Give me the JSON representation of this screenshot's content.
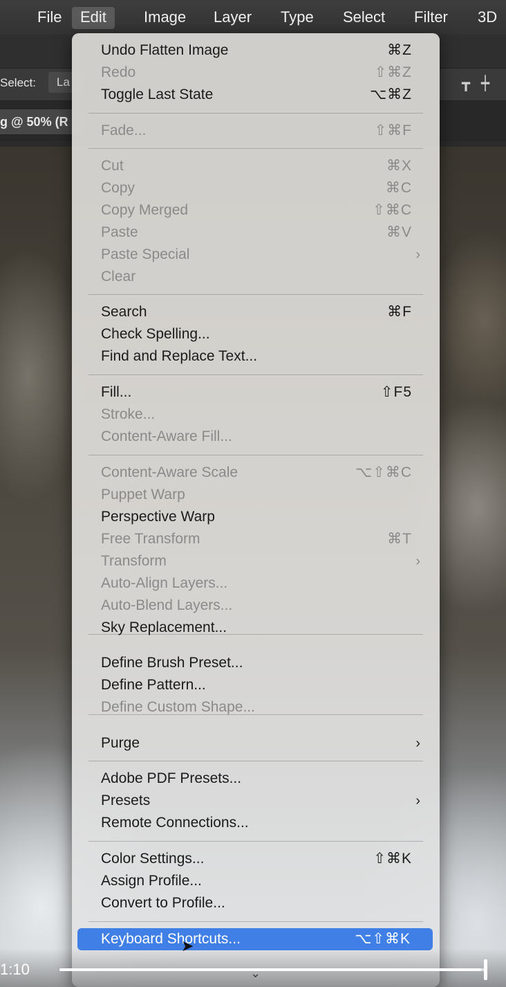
{
  "menubar": {
    "items": [
      {
        "label": "File"
      },
      {
        "label": "Edit"
      },
      {
        "label": "Image"
      },
      {
        "label": "Layer"
      },
      {
        "label": "Type"
      },
      {
        "label": "Select"
      },
      {
        "label": "Filter"
      },
      {
        "label": "3D"
      }
    ],
    "active": "Edit"
  },
  "options_bar": {
    "select_label": "Select:",
    "select_value": "La"
  },
  "document_tab": {
    "label": "g @ 50% (R"
  },
  "edit_menu": {
    "items": [
      {
        "label": "Undo Flatten Image",
        "shortcut": "⌘Z",
        "enabled": true
      },
      {
        "label": "Redo",
        "shortcut": "⇧⌘Z",
        "enabled": false
      },
      {
        "label": "Toggle Last State",
        "shortcut": "⌥⌘Z",
        "enabled": true
      },
      {
        "label": "Fade...",
        "shortcut": "⇧⌘F",
        "enabled": false
      },
      {
        "label": "Cut",
        "shortcut": "⌘X",
        "enabled": false
      },
      {
        "label": "Copy",
        "shortcut": "⌘C",
        "enabled": false
      },
      {
        "label": "Copy Merged",
        "shortcut": "⇧⌘C",
        "enabled": false
      },
      {
        "label": "Paste",
        "shortcut": "⌘V",
        "enabled": false
      },
      {
        "label": "Paste Special",
        "shortcut": "",
        "enabled": false,
        "submenu": true
      },
      {
        "label": "Clear",
        "shortcut": "",
        "enabled": false
      },
      {
        "label": "Search",
        "shortcut": "⌘F",
        "enabled": true
      },
      {
        "label": "Check Spelling...",
        "shortcut": "",
        "enabled": true
      },
      {
        "label": "Find and Replace Text...",
        "shortcut": "",
        "enabled": true
      },
      {
        "label": "Fill...",
        "shortcut": "⇧F5",
        "enabled": true
      },
      {
        "label": "Stroke...",
        "shortcut": "",
        "enabled": false
      },
      {
        "label": "Content-Aware Fill...",
        "shortcut": "",
        "enabled": false
      },
      {
        "label": "Content-Aware Scale",
        "shortcut": "⌥⇧⌘C",
        "enabled": false
      },
      {
        "label": "Puppet Warp",
        "shortcut": "",
        "enabled": false
      },
      {
        "label": "Perspective Warp",
        "shortcut": "",
        "enabled": true
      },
      {
        "label": "Free Transform",
        "shortcut": "⌘T",
        "enabled": false
      },
      {
        "label": "Transform",
        "shortcut": "",
        "enabled": false,
        "submenu": true
      },
      {
        "label": "Auto-Align Layers...",
        "shortcut": "",
        "enabled": false
      },
      {
        "label": "Auto-Blend Layers...",
        "shortcut": "",
        "enabled": false
      },
      {
        "label": "Sky Replacement...",
        "shortcut": "",
        "enabled": true
      },
      {
        "label": "Define Brush Preset...",
        "shortcut": "",
        "enabled": true
      },
      {
        "label": "Define Pattern...",
        "shortcut": "",
        "enabled": true
      },
      {
        "label": "Define Custom Shape...",
        "shortcut": "",
        "enabled": false
      },
      {
        "label": "Purge",
        "shortcut": "",
        "enabled": true,
        "submenu": true
      },
      {
        "label": "Adobe PDF Presets...",
        "shortcut": "",
        "enabled": true
      },
      {
        "label": "Presets",
        "shortcut": "",
        "enabled": true,
        "submenu": true
      },
      {
        "label": "Remote Connections...",
        "shortcut": "",
        "enabled": true
      },
      {
        "label": "Color Settings...",
        "shortcut": "⇧⌘K",
        "enabled": true
      },
      {
        "label": "Assign Profile...",
        "shortcut": "",
        "enabled": true
      },
      {
        "label": "Convert to Profile...",
        "shortcut": "",
        "enabled": true
      },
      {
        "label": "Keyboard Shortcuts...",
        "shortcut": "⌥⇧⌘K",
        "enabled": true,
        "highlighted": true
      }
    ],
    "submenu_glyph": "›",
    "more_glyph": "⌄"
  },
  "player": {
    "time": "1:10",
    "progress": 0.99
  },
  "colors": {
    "highlight": "#3f7fe6",
    "menu_bg": "#d6d4d0",
    "disabled_text": "#8a8a8a"
  }
}
